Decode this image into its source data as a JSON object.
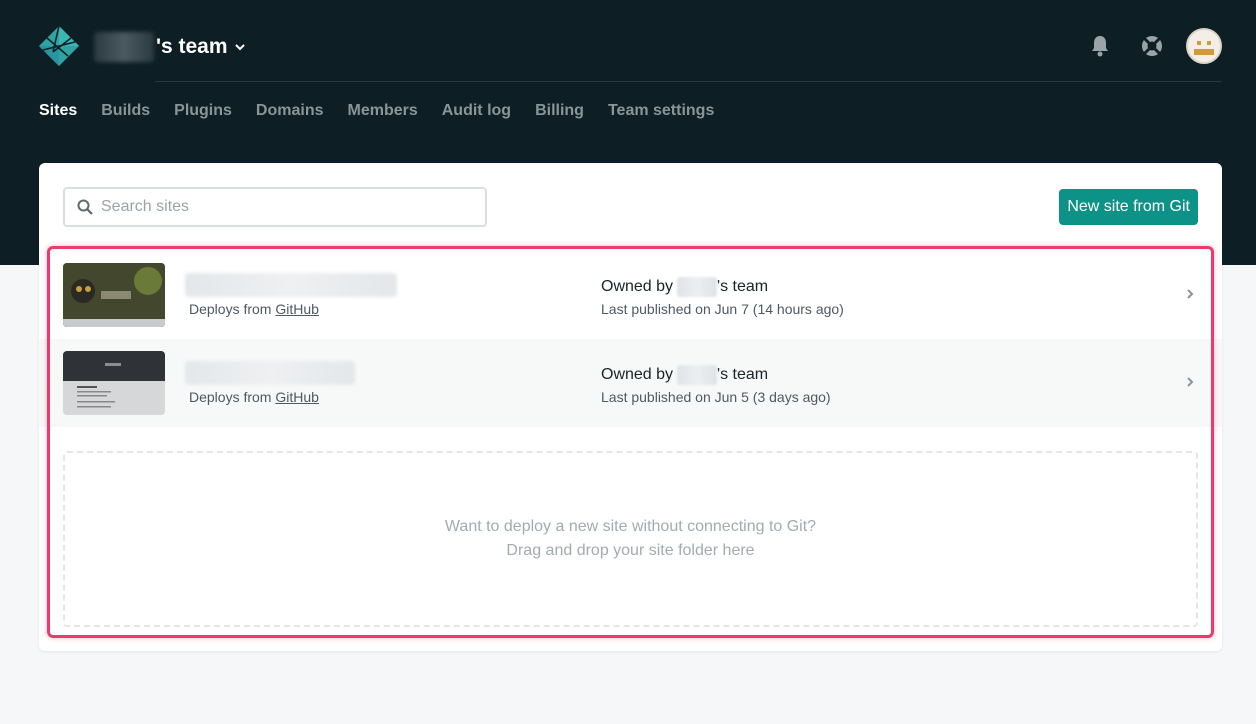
{
  "header": {
    "team_suffix": "'s team",
    "icons": [
      "netlify-logo-icon",
      "chevron-down-icon",
      "bell-icon",
      "help-lifebuoy-icon",
      "avatar"
    ]
  },
  "nav": {
    "items": [
      {
        "label": "Sites",
        "active": true
      },
      {
        "label": "Builds"
      },
      {
        "label": "Plugins"
      },
      {
        "label": "Domains"
      },
      {
        "label": "Members"
      },
      {
        "label": "Audit log"
      },
      {
        "label": "Billing"
      },
      {
        "label": "Team settings"
      }
    ]
  },
  "search": {
    "placeholder": "Search sites"
  },
  "new_site_button": "New site from Git",
  "sites": [
    {
      "deploys_prefix": "Deploys from",
      "deploys_source": "GitHub",
      "owned_prefix": "Owned by",
      "owned_suffix": "'s team",
      "published": "Last published on Jun 7 (14 hours ago)"
    },
    {
      "deploys_prefix": "Deploys from",
      "deploys_source": "GitHub",
      "owned_prefix": "Owned by",
      "owned_suffix": "'s team",
      "published": "Last published on Jun 5 (3 days ago)"
    }
  ],
  "dropzone": {
    "line1": "Want to deploy a new site without connecting to Git?",
    "line2": "Drag and drop your site folder here"
  },
  "colors": {
    "header_bg": "#0e1e25",
    "accent": "#0d9287",
    "highlight": "#ec3b6b"
  }
}
